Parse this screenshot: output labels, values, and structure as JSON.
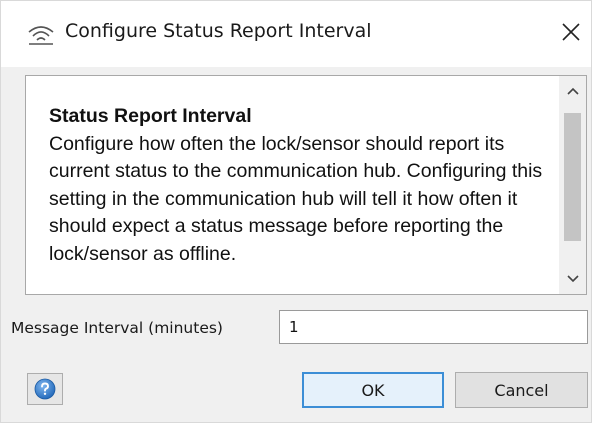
{
  "window": {
    "title": "Configure Status Report Interval",
    "title_icon": "wifi-signal-icon",
    "close_icon": "close-icon"
  },
  "description": {
    "heading": "Status Report Interval",
    "body": "Configure how often the lock/sensor should report its current status to the communication hub. Configuring this setting in the communication hub will tell it how often it should expect a status message before reporting the lock/sensor as offline."
  },
  "interval_field": {
    "label": "Message Interval (minutes)",
    "value": "1"
  },
  "buttons": {
    "help_icon": "help-question-icon",
    "ok_label": "OK",
    "cancel_label": "Cancel"
  },
  "colors": {
    "help_icon": "#2f7fd1",
    "ok_border": "#3c8ed6"
  }
}
